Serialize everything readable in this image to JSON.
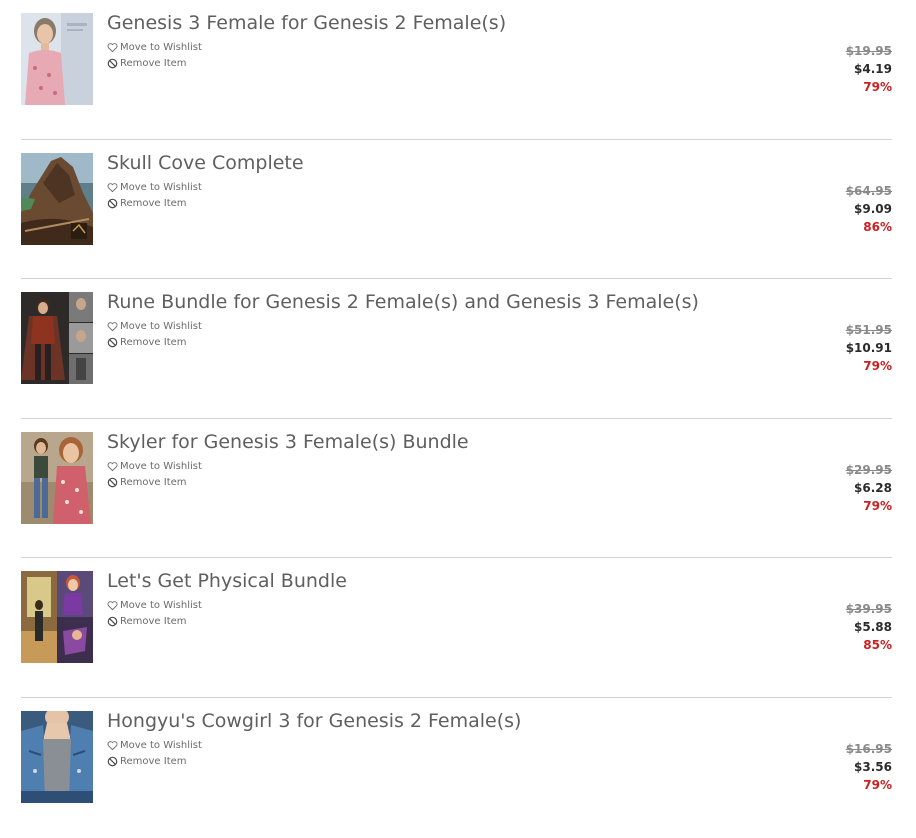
{
  "actions": {
    "wishlist_label": "Move to Wishlist",
    "remove_label": "Remove Item"
  },
  "colors": {
    "discount": "#cc2020",
    "title": "#5f5f5f",
    "divider": "#d3d3d3"
  },
  "items": [
    {
      "title": "Genesis 3 Female for Genesis 2 Female(s)",
      "original_price": "$19.95",
      "sale_price": "$4.19",
      "discount": "79%"
    },
    {
      "title": "Skull Cove Complete",
      "original_price": "$64.95",
      "sale_price": "$9.09",
      "discount": "86%"
    },
    {
      "title": "Rune Bundle for Genesis 2 Female(s) and Genesis 3 Female(s)",
      "original_price": "$51.95",
      "sale_price": "$10.91",
      "discount": "79%"
    },
    {
      "title": "Skyler for Genesis 3 Female(s) Bundle",
      "original_price": "$29.95",
      "sale_price": "$6.28",
      "discount": "79%"
    },
    {
      "title": "Let's Get Physical Bundle",
      "original_price": "$39.95",
      "sale_price": "$5.88",
      "discount": "85%"
    },
    {
      "title": "Hongyu's Cowgirl 3 for Genesis 2 Female(s)",
      "original_price": "$16.95",
      "sale_price": "$3.56",
      "discount": "79%"
    }
  ]
}
